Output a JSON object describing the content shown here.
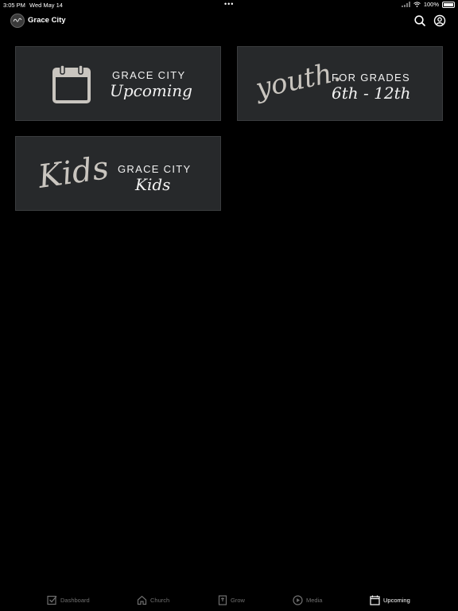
{
  "status_bar": {
    "time": "3:05 PM",
    "date": "Wed May 14",
    "battery": "100%",
    "dots": "•••"
  },
  "header": {
    "title": "Grace City",
    "logo_icon": "grace-city-logo",
    "search_icon": "search-icon",
    "account_icon": "account-circle-icon"
  },
  "tiles": [
    {
      "caps": "GRACE CITY",
      "script": "Upcoming",
      "art_icon": "calendar-icon"
    },
    {
      "caps": "FOR GRADES",
      "script": "6th - 12th",
      "art_text": "youth."
    },
    {
      "caps": "GRACE CITY",
      "script": "Kids",
      "art_text": "Kids"
    }
  ],
  "tab_bar": {
    "items": [
      {
        "label": "Dashboard",
        "icon": "checkbox-icon",
        "active": false
      },
      {
        "label": "Church",
        "icon": "home-icon",
        "active": false
      },
      {
        "label": "Grow",
        "icon": "book-icon",
        "active": false
      },
      {
        "label": "Media",
        "icon": "play-circle-icon",
        "active": false
      },
      {
        "label": "Upcoming",
        "icon": "calendar-icon",
        "active": true
      }
    ]
  },
  "colors": {
    "background": "#000000",
    "tile": "#27292b",
    "tile_border": "#3a3c3e",
    "icon_art": "#c9c5bf",
    "inactive_tab": "#6f6f6f",
    "active_tab": "#ffffff"
  }
}
